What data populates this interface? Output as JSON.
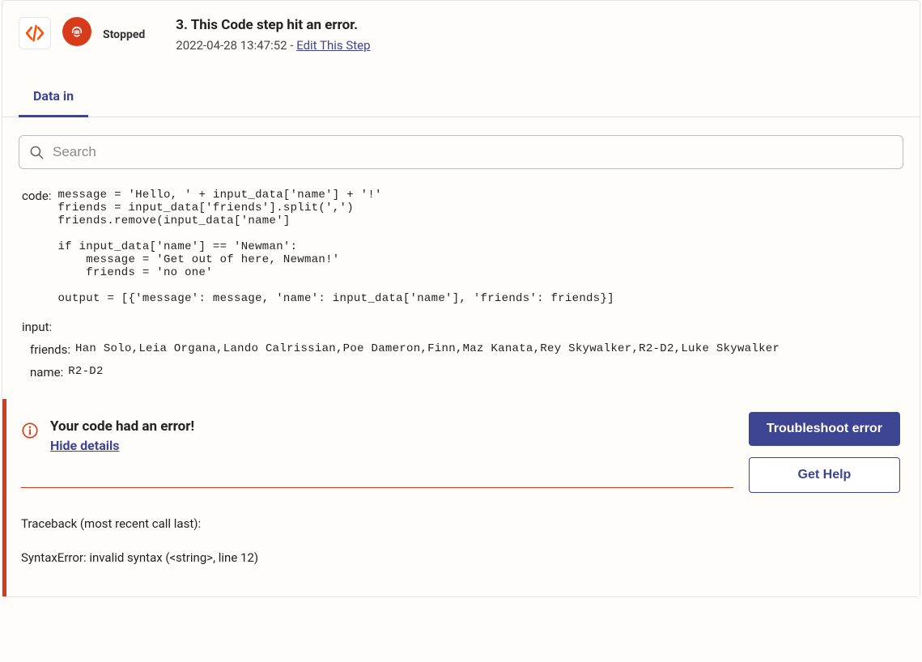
{
  "header": {
    "status_label": "Stopped",
    "title": "3. This Code step hit an error.",
    "timestamp": "2022-04-28 13:47:52",
    "separator": " - ",
    "edit_link": "Edit This Step"
  },
  "tabs": {
    "active": "Data in"
  },
  "search": {
    "placeholder": "Search"
  },
  "data_in": {
    "code_key": "code:",
    "code_value": "message = 'Hello, ' + input_data['name'] + '!'\nfriends = input_data['friends'].split(',')\nfriends.remove(input_data['name']\n\nif input_data['name'] == 'Newman':\n    message = 'Get out of here, Newman!'\n    friends = 'no one'\n\noutput = [{'message': message, 'name': input_data['name'], 'friends': friends}]",
    "input_key": "input:",
    "friends_key": "friends:",
    "friends_value": "Han Solo,Leia Organa,Lando Calrissian,Poe Dameron,Finn,Maz Kanata,Rey Skywalker,R2-D2,Luke Skywalker",
    "name_key": "name:",
    "name_value": "R2-D2"
  },
  "error": {
    "title": "Your code had an error!",
    "hide_details": "Hide details",
    "troubleshoot_btn": "Troubleshoot error",
    "gethelp_btn": "Get Help",
    "traceback1": "Traceback (most recent call last):",
    "traceback2": "SyntaxError: invalid syntax (<string>, line 12)"
  }
}
